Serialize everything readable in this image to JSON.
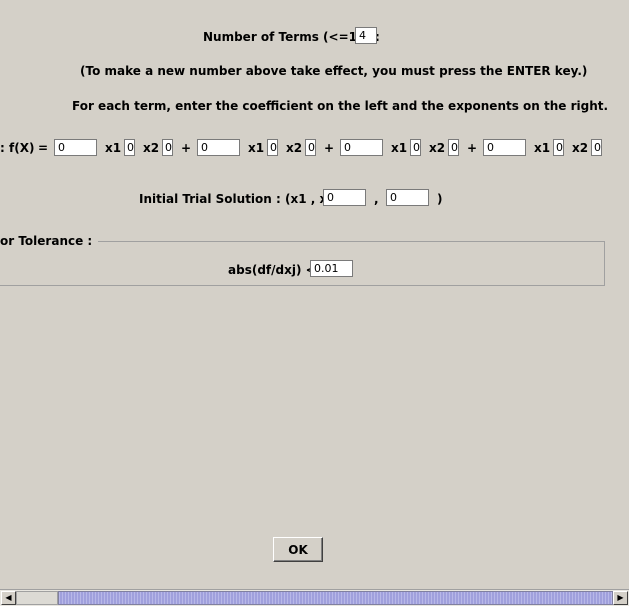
{
  "num_terms": {
    "label": "Number of Terms (<=10) :",
    "value": "4"
  },
  "note": "(To make a new number above take effect, you must press the ENTER key.)",
  "instructions": "For each term, enter the coefficient on the left and the exponents on the right.",
  "function": {
    "prefix": ":",
    "fx_label": "f(X)",
    "equals": "=",
    "x1_label": "x1",
    "x2_label": "x2",
    "plus": "+",
    "terms": [
      {
        "coef": "0",
        "x1_exp": "0",
        "x2_exp": "0"
      },
      {
        "coef": "0",
        "x1_exp": "0",
        "x2_exp": "0"
      },
      {
        "coef": "0",
        "x1_exp": "0",
        "x2_exp": "0"
      },
      {
        "coef": "0",
        "x1_exp": "0",
        "x2_exp": "0"
      }
    ]
  },
  "initial": {
    "label": "Initial Trial Solution : (x1 , x2) = (",
    "x1": "0",
    "comma": ",",
    "x2": "0",
    "close": ")"
  },
  "tolerance": {
    "group_title": "or Tolerance :",
    "label": "abs(df/dxj) <=",
    "value": "0.01"
  },
  "ok_button": "OK",
  "scrollbar": {
    "left_arrow": "◀",
    "right_arrow": "▶"
  }
}
